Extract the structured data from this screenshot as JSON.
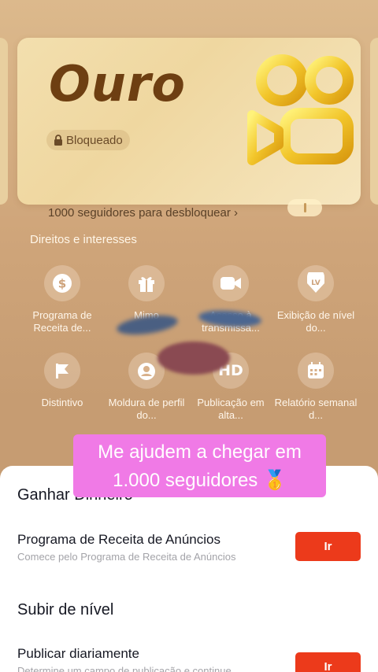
{
  "card": {
    "tier": "Ouro",
    "status": "Bloqueado",
    "unlock_text": "1000 seguidores para desbloquear",
    "unlock_chevron": "›"
  },
  "rights": {
    "title": "Direitos e interesses",
    "items": [
      {
        "label": "Programa de Receita de...",
        "icon": "dollar-icon"
      },
      {
        "label": "Mimo",
        "icon": "gift-icon"
      },
      {
        "label": "Acesso à transmissa...",
        "icon": "video-camera-icon"
      },
      {
        "label": "Exibição de nível do...",
        "icon": "level-badge-icon",
        "icon_text": "LV"
      },
      {
        "label": "Distintivo",
        "icon": "flag-icon"
      },
      {
        "label": "Moldura de perfil do...",
        "icon": "profile-frame-icon"
      },
      {
        "label": "Publicação em alta...",
        "icon": "hd-icon",
        "icon_text": "HD"
      },
      {
        "label": "Relatório semanal d...",
        "icon": "calendar-icon"
      }
    ]
  },
  "caption": {
    "line1": "Me ajudem a chegar em",
    "line2": "1.000 seguidores 🥇"
  },
  "sheet": {
    "earn_title": "Ganhar Dinheiro",
    "task1_title": "Programa de Receita de Anúncios",
    "task1_sub": "Comece pelo Programa de Receita de Anúncios",
    "task1_button": "Ir",
    "level_title": "Subir de nível",
    "task2_title": "Publicar diariamente",
    "task2_sub": "Determine um campo de publicação e continue",
    "task2_button": "Ir"
  },
  "colors": {
    "accent_button": "#ec3a1b",
    "caption_bg": "#f07ae6",
    "tier_text": "#6e3f12"
  }
}
